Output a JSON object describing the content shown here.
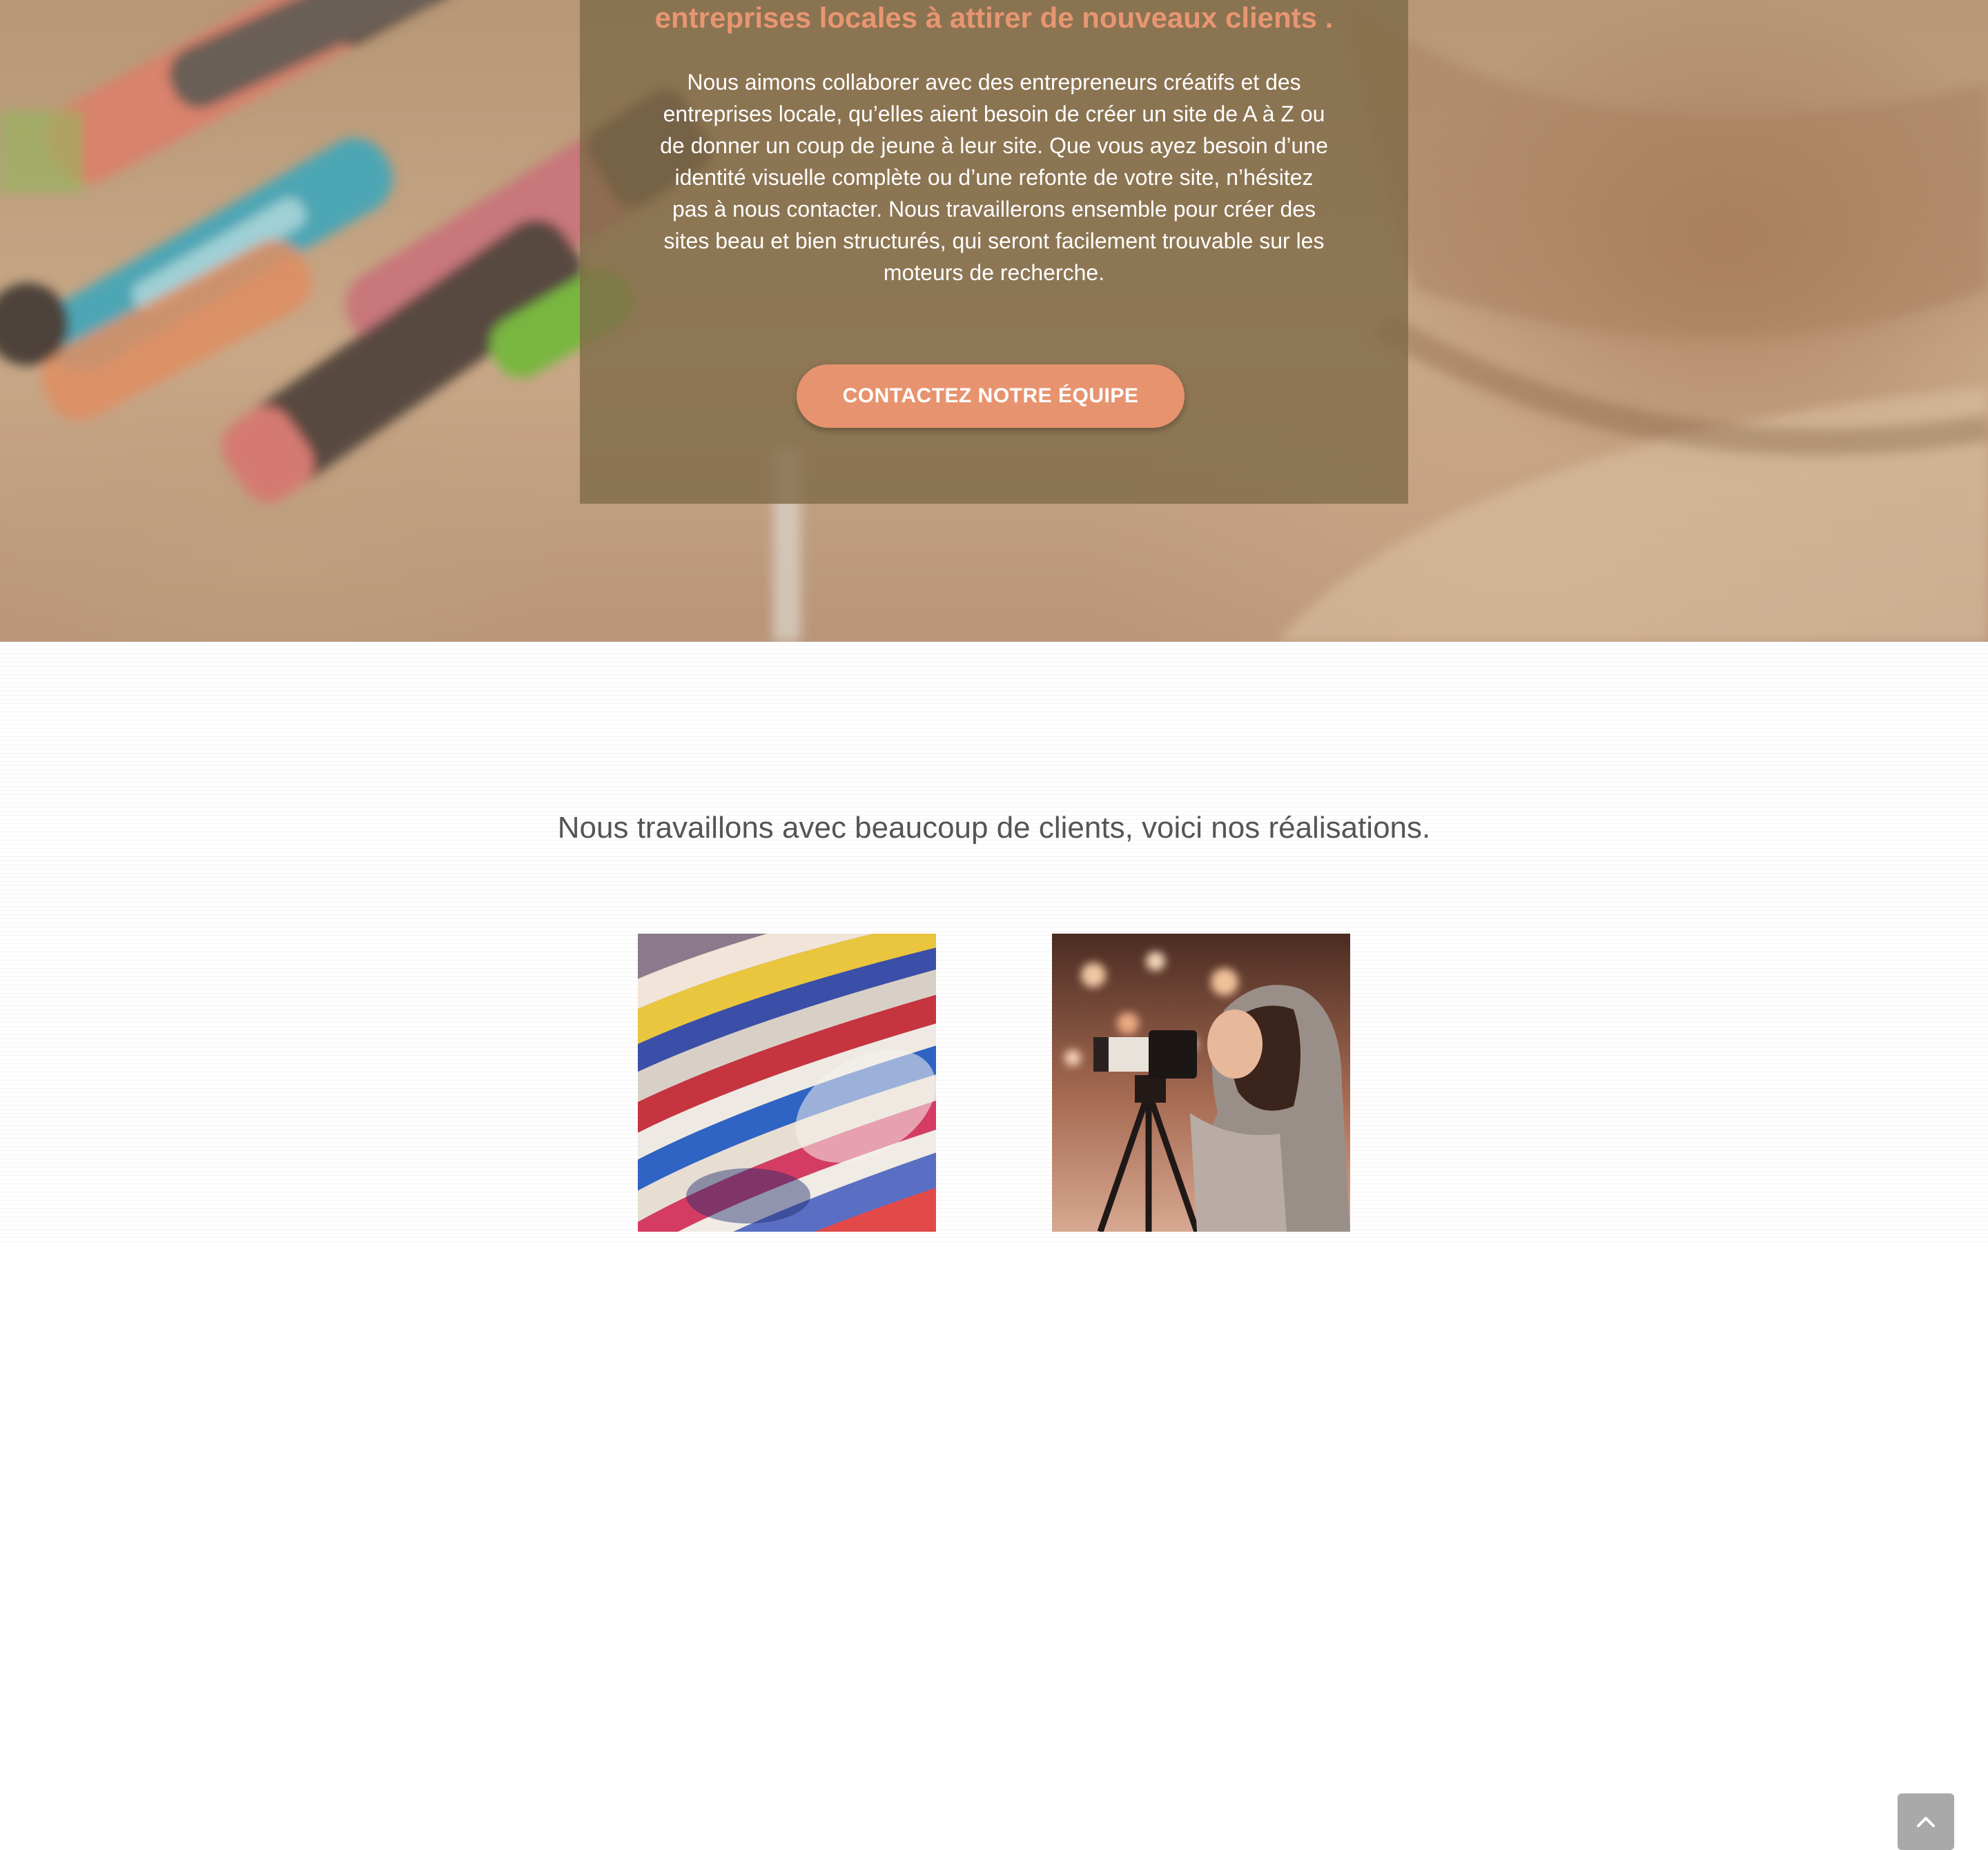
{
  "hero": {
    "heading": "entreprises locales à attirer de nouveaux clients .",
    "body": "Nous aimons collaborer avec des entrepreneurs créatifs et des entreprises locale, qu’elles aient besoin de créer un site de A à Z ou de donner un coup de jeune à leur site. Que vous ayez besoin d’une identité visuelle complète ou d’une refonte de votre site, n’hésitez pas à nous contacter. Nous travaillerons ensemble pour créer des sites beau et bien structurés, qui seront facilement trouvable sur les moteurs de recherche.",
    "cta_label": "CONTACTEZ NOTRE ÉQUIPE"
  },
  "work": {
    "title": "Nous travaillons avec beaucoup de clients, voici nos réalisations.",
    "items": [
      {
        "icon": "magazines-image"
      },
      {
        "icon": "photographer-image"
      }
    ]
  },
  "controls": {
    "back_to_top_icon": "chevron-up-icon"
  },
  "colors": {
    "accent": "#e8936f",
    "card_overlay": "#7d6946",
    "body_text": "#555555",
    "back_to_top": "#a9a9a9"
  }
}
